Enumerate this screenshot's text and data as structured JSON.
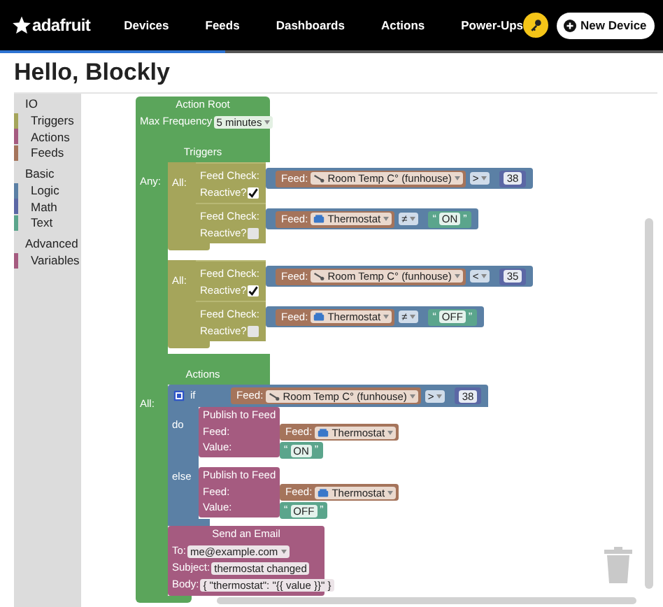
{
  "header": {
    "logo": "adafruit",
    "nav": [
      "Devices",
      "Feeds",
      "Dashboards",
      "Actions",
      "Power-Ups"
    ],
    "new_device_button": "New Device",
    "progress": {
      "level": 0.34
    }
  },
  "page_title": "Hello, Blockly",
  "toolbox": [
    {
      "label": "IO",
      "children": [
        {
          "label": "Triggers",
          "color": "#a5a55b"
        },
        {
          "label": "Actions",
          "color": "#a55b80"
        },
        {
          "label": "Feeds",
          "color": "#a5745b"
        }
      ]
    },
    {
      "label": "Basic",
      "children": [
        {
          "label": "Logic",
          "color": "#5b80a5"
        },
        {
          "label": "Math",
          "color": "#5b67a5"
        },
        {
          "label": "Text",
          "color": "#5ba58c"
        }
      ]
    },
    {
      "label": "Advanced",
      "children": [
        {
          "label": "Variables",
          "color": "#a55b80"
        }
      ]
    }
  ],
  "action_root": {
    "title": "Action Root",
    "max_frequency_label": "Max Frequency",
    "max_frequency": "5 minutes",
    "triggers_label": "Triggers",
    "any_label": "Any:",
    "actions_label": "Actions",
    "all_label": "All:"
  },
  "trigger_groups": [
    {
      "label": "All:",
      "checks": [
        {
          "label": "Feed Check:",
          "feed_label": "Feed:",
          "feed": {
            "kind": "sensor",
            "name": "Room Temp C° (funhouse)"
          },
          "operator": ">",
          "value": {
            "kind": "number",
            "text": "38"
          },
          "reactive_label": "Reactive?",
          "reactive": true
        },
        {
          "label": "Feed Check:",
          "feed_label": "Feed:",
          "feed": {
            "kind": "device",
            "name": "Thermostat"
          },
          "operator": "≠",
          "value": {
            "kind": "text",
            "open_quote": "“",
            "text": "ON",
            "close_quote": "”"
          },
          "reactive_label": "Reactive?",
          "reactive": false
        }
      ]
    },
    {
      "label": "All:",
      "checks": [
        {
          "label": "Feed Check:",
          "feed_label": "Feed:",
          "feed": {
            "kind": "sensor",
            "name": "Room Temp C° (funhouse)"
          },
          "operator": "<",
          "value": {
            "kind": "number",
            "text": "35"
          },
          "reactive_label": "Reactive?",
          "reactive": true
        },
        {
          "label": "Feed Check:",
          "feed_label": "Feed:",
          "feed": {
            "kind": "device",
            "name": "Thermostat"
          },
          "operator": "≠",
          "value": {
            "kind": "text",
            "open_quote": "“",
            "text": "OFF",
            "close_quote": "”"
          },
          "reactive_label": "Reactive?",
          "reactive": false
        }
      ]
    }
  ],
  "if_block": {
    "if_label": "if",
    "condition": {
      "feed_label": "Feed:",
      "feed": {
        "kind": "sensor",
        "name": "Room Temp C° (funhouse)"
      },
      "operator": ">",
      "value": {
        "kind": "number",
        "text": "38"
      }
    },
    "branches": [
      {
        "label": "do",
        "title": "Publish to Feed",
        "feed_label": "Feed:",
        "feed_block_label": "Feed:",
        "feed": {
          "kind": "device",
          "name": "Thermostat"
        },
        "value_label": "Value:",
        "value": {
          "kind": "text",
          "open_quote": "“",
          "text": "ON",
          "close_quote": "”"
        }
      },
      {
        "label": "else",
        "title": "Publish to Feed",
        "feed_label": "Feed:",
        "feed_block_label": "Feed:",
        "feed": {
          "kind": "device",
          "name": "Thermostat"
        },
        "value_label": "Value:",
        "value": {
          "kind": "text",
          "open_quote": "“",
          "text": "OFF",
          "close_quote": "”"
        }
      }
    ]
  },
  "email": {
    "title": "Send an Email",
    "to_label": "To:",
    "to": "me@example.com",
    "subject_label": "Subject:",
    "subject": "thermostat changed",
    "body_label": "Body:",
    "body": "{ \"thermostat\": \"{{ value }}\" }"
  }
}
